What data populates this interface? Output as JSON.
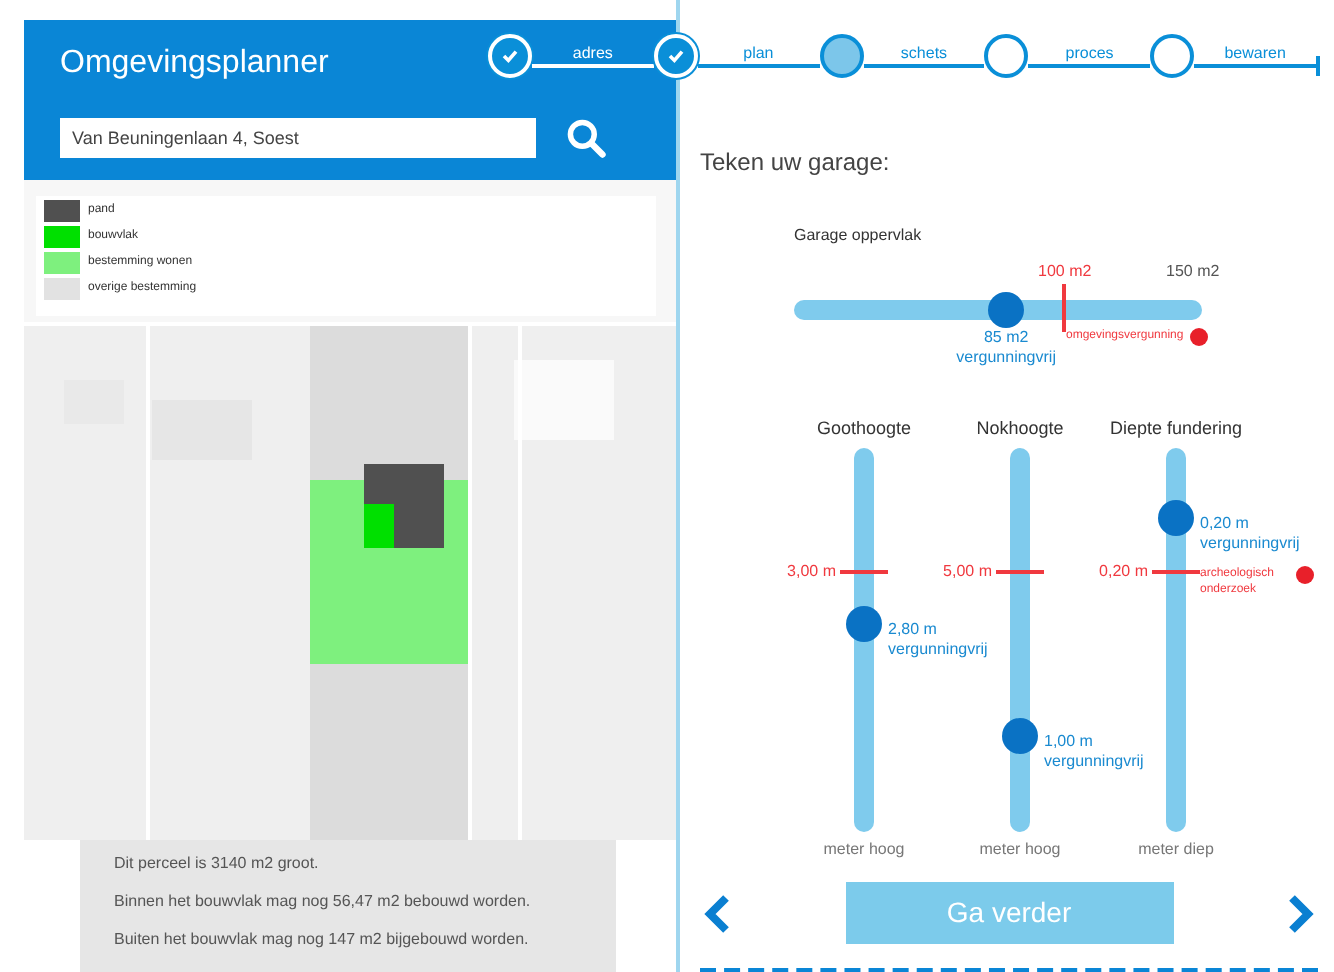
{
  "header": {
    "title": "Omgevingsplanner",
    "search": {
      "value": "Van Beuningenlaan 4, Soest"
    }
  },
  "steps": [
    {
      "label": "adres",
      "completed": true,
      "selected": false
    },
    {
      "label": "plan",
      "completed": true,
      "selected": false
    },
    {
      "label": "schets",
      "completed": false,
      "selected": true
    },
    {
      "label": "proces",
      "completed": false,
      "selected": false
    },
    {
      "label": "bewaren",
      "completed": false,
      "selected": false
    }
  ],
  "legend": [
    {
      "label": "pand",
      "color": "#505050"
    },
    {
      "label": "bouwvlak",
      "color": "#00e000"
    },
    {
      "label": "bestemming wonen",
      "color": "#7ef07e"
    },
    {
      "label": "overige bestemming",
      "color": "#e2e2e2"
    }
  ],
  "parcel_info": [
    "Dit perceel is 3140 m2 groot.",
    "Binnen het bouwvlak mag nog 56,47 m2 bebouwd worden.",
    "Buiten het bouwvlak mag nog 147 m2 bijgebouwd worden."
  ],
  "panel_title": "Teken uw garage:",
  "area_slider": {
    "label": "Garage oppervlak",
    "level": 0.52,
    "value": "85 m2",
    "status": "vergunningvrij",
    "limit": "100 m2",
    "max": "150 m2",
    "warning": "omgevingsvergunning"
  },
  "vertical_sliders": [
    {
      "label": "Goothoogte",
      "level": 0.54,
      "value": "2,80 m",
      "status": "vergunningvrij",
      "limit": "3,00 m",
      "unit": "meter hoog"
    },
    {
      "label": "Nokhoogte",
      "level": 0.25,
      "value": "1,00 m",
      "status": "vergunningvrij",
      "limit": "5,00 m",
      "unit": "meter hoog"
    },
    {
      "label": "Diepte fundering",
      "level": 0.82,
      "value": "0,20 m",
      "status": "vergunningvrij",
      "limit": "0,20 m",
      "warning": "archeologisch onderzoek",
      "unit": "meter diep"
    }
  ],
  "continue_button": "Ga verder"
}
